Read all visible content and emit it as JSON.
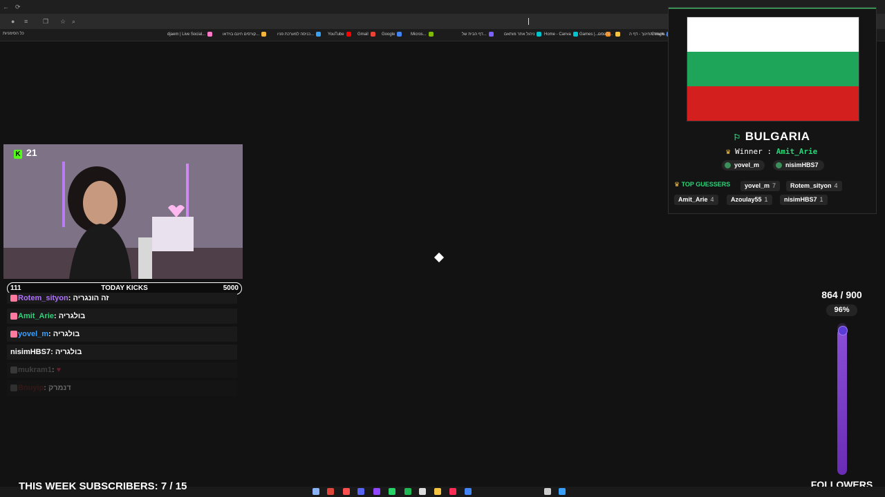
{
  "browser": {
    "bookmarks_bar": {
      "folder_label": "כל הסימניות",
      "items": [
        {
          "label": "djaem | Live Social...",
          "color": "#ff7ac6"
        },
        {
          "label": "קורסים חינם בוידאו...",
          "color": "#f2b53a"
        },
        {
          "label": "כניסה למערכת פניו...",
          "color": "#3aa0f2"
        },
        {
          "label": "YouTube",
          "color": "#ff0000"
        },
        {
          "label": "Gmail",
          "color": "#ea4335"
        },
        {
          "label": "Google",
          "color": "#4285f4"
        },
        {
          "label": "Micros...",
          "color": "#7fba00"
        },
        {
          "label": "דף הבית של...",
          "color": "#7b61ff"
        },
        {
          "label": "ניהול אתר מותאם",
          "color": "#00c4cc"
        },
        {
          "label": "Home - Canva",
          "color": "#00c4cc"
        },
        {
          "label": "Games |...- ס",
          "color": "#f58b1f"
        },
        {
          "label": "ג'וגרים...",
          "color": "#f5c542"
        },
        {
          "label": "משרד החינוך - דף ה...",
          "color": "#3a7bd5"
        },
        {
          "label": "Google",
          "color": "#4285f4"
        }
      ]
    }
  },
  "stream": {
    "kick_followers_badge": "21",
    "today_kicks": {
      "current": "111",
      "label": "TODAY KICKS",
      "goal": "5000"
    },
    "chat": [
      {
        "user": "Rotem_sityon",
        "message": "זה הונגריה",
        "user_color": "#b070ff"
      },
      {
        "user": "Amit_Arie",
        "message": "בולגריה",
        "user_color": "#2cd47a"
      },
      {
        "user": "yovel_m",
        "message": "בולגריה",
        "user_color": "#3aa0ff"
      },
      {
        "user": "nisimHBS7",
        "message": "בולגריה",
        "user_color": "#ffffff"
      },
      {
        "user": "mukram1",
        "message": "♥",
        "user_color": "#777777"
      },
      {
        "user": "Bnuyip",
        "message": "דנמרק",
        "user_color": "#7a2222"
      }
    ],
    "subscribers": {
      "label": "THIS WEEK SUBSCRIBERS: 7 / 15",
      "current": 7,
      "goal": 15
    },
    "followers_goal": {
      "count_label": "864 / 900",
      "percent_label": "96%",
      "fraction": 0.96,
      "label": "FOLLOWERS"
    }
  },
  "geo_game": {
    "flag_colors": [
      "#ffffff",
      "#1ea55a",
      "#d41f1f"
    ],
    "country": "BULGARIA",
    "winner_label": "Winner",
    "winner_name": "Amit_Arie",
    "correct_guessers": [
      "yovel_m",
      "nisimHBS7"
    ],
    "top_guessers_label": "TOP GUESSERS",
    "top_guessers": [
      {
        "name": "yovel_m",
        "score": "7"
      },
      {
        "name": "Rotem_sityon",
        "score": "4"
      },
      {
        "name": "Amit_Arie",
        "score": "4"
      },
      {
        "name": "Azoulay55",
        "score": "1"
      },
      {
        "name": "nisimHBS7",
        "score": "1"
      }
    ]
  },
  "colors": {
    "accent_green": "#2cd47a",
    "kick_green": "#53fc18",
    "gold": "#f5c542",
    "goal_purple": "#7b3fd0"
  }
}
